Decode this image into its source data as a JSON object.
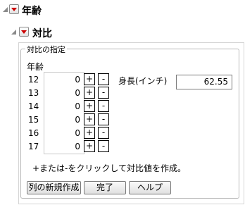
{
  "outer_header": {
    "title": "年齢"
  },
  "inner_header": {
    "title": "対比"
  },
  "group": {
    "legend": "対比の指定",
    "factor_label": "年齢",
    "levels": [
      {
        "label": "12",
        "value": "0"
      },
      {
        "label": "13",
        "value": "0"
      },
      {
        "label": "14",
        "value": "0"
      },
      {
        "label": "15",
        "value": "0"
      },
      {
        "label": "16",
        "value": "0"
      },
      {
        "label": "17",
        "value": "0"
      }
    ],
    "plus_label": "+",
    "minus_label": "-",
    "response_label": "身長(インチ)",
    "response_value": "62.55",
    "hint": "+または-をクリックして対比値を作成。",
    "buttons": {
      "new_column": "列の新規作成",
      "done": "完了",
      "help": "ヘルプ"
    }
  },
  "colors": {
    "disclosure_red": "#cc0000",
    "border_gray": "#b9b9b9"
  },
  "icons": {
    "outline_toggle": "outline-collapse-icon",
    "popup_menu": "red-triangle-menu-icon"
  }
}
